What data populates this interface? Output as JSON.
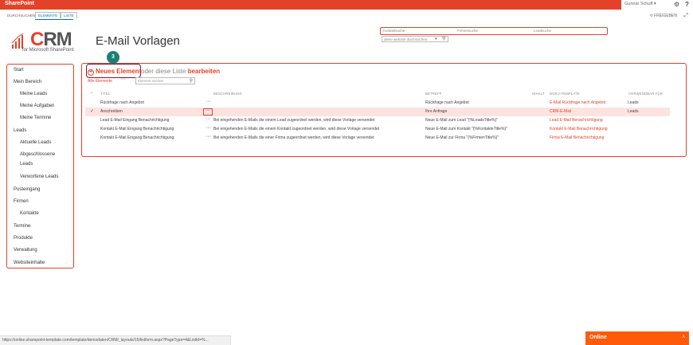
{
  "suitebar": {
    "brand": "SharePoint",
    "user": "Gunnar Schuff ▾",
    "gear": "⚙",
    "help": "?"
  },
  "ribbon": {
    "tabs": [
      "DURCHSUCHEN",
      "ELEMENTE",
      "LISTE"
    ],
    "share": "⟲ FREIGEBEN",
    "focus": "⤢"
  },
  "logo": {
    "mark": "CRM",
    "subtitle": "for Microsoft SharePoint"
  },
  "page_title": "E-Mail Vorlagen",
  "search": {
    "fields": [
      "Kontaktsuche",
      "Firmensuche",
      "Leadsuche"
    ],
    "site_placeholder": "diese website durchsuchen"
  },
  "nav": [
    "Start",
    "Mein Bereich",
    "Meine Leads",
    "Meine Aufgaben",
    "Meine Termine",
    "Leads",
    "Aktuelle Leads",
    "Abgeschlossene",
    "Leads",
    "Verworfene Leads",
    "Posteingang",
    "Firmen",
    "Kontakte",
    "Termine",
    "Produkte",
    "Verwaltung",
    "Websiteinhalte"
  ],
  "callout_number": "3",
  "list": {
    "new_item": "Neues Element",
    "or_edit_prefix": "oder diese Liste",
    "edit": "bearbeiten",
    "all_items": "Alle Elemente",
    "find_placeholder": "Element suchen",
    "columns": [
      "TITEL",
      "BESCHREIBUNG",
      "BETREFF",
      "INHALT",
      "DOKU-TEMPLATE",
      "VORWENDBAR FÜR"
    ],
    "rows": [
      {
        "title": "Rückfrage nach Angebot",
        "desc": "",
        "subject": "Rückfrage nach Angebot",
        "template": "E-Mail Rückfrage nach Angebot",
        "usable": "Leads",
        "selected": false
      },
      {
        "title": "Anschreiben",
        "desc": "",
        "subject": "Ihre Anfrage",
        "template": "CRM-E-Mail",
        "usable": "Leads",
        "selected": true
      },
      {
        "title": "Lead E-Mail Eingang Benachrichtigung",
        "desc": "Bei eingehenden E-Mails die einem Lead zugeordnet werden, wird diese Vorlage versendet",
        "subject": "Neue E-Mail zum Lead \"{%LeadsTitle%}\"",
        "template": "Lead E-Mail Benachrichtigung",
        "usable": "",
        "selected": false
      },
      {
        "title": "Kontakt E-Mail Eingang Benachrichtigung",
        "desc": "Bei eingehenden E-Mails die einem Kontakt zugeordnet werden, wird diese Vorlage versendet",
        "subject": "Neue E-Mail zum Kontakt \"{%KontakteTitle%}\"",
        "template": "Kontakt E-Mail Benachrichtigung",
        "usable": "",
        "selected": false
      },
      {
        "title": "Kontakt E-Mail Eingang Benachrichtigung",
        "desc": "Bei eingehenden E-Mails die einer Firma zugeordnet werden, wird diese Vorlage versendet",
        "subject": "Neue E-Mail zur Firma \"{%FirmenTitle%}\"",
        "template": "Firma E-Mail Benachrichtigung",
        "usable": "",
        "selected": false
      }
    ]
  },
  "statusbar": "https://online.sharepoint-template.com/template/demodaten/CRM/_layouts/15/listform.aspx?PageType=4&ListId=%...",
  "online": {
    "label": "Online",
    "chevron": "˄"
  },
  "colors": {
    "accent": "#e4412b",
    "badge": "#1a7f78",
    "online": "#ff5a0a"
  }
}
